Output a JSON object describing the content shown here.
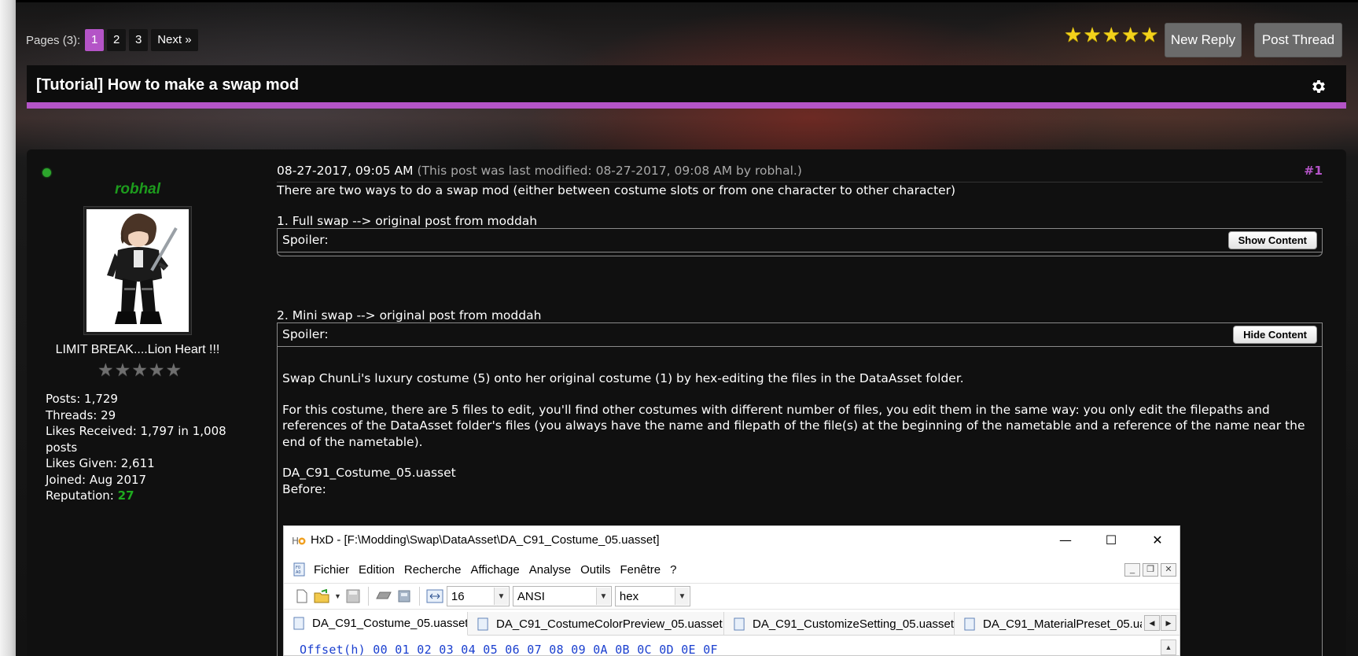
{
  "pagination": {
    "label": "Pages (3):",
    "pages": [
      "1",
      "2",
      "3"
    ],
    "current": "1",
    "next_label": "Next »"
  },
  "thread_rating": {
    "stars": 5,
    "max": 5
  },
  "actions": {
    "new_reply": "New Reply",
    "post_thread": "Post Thread"
  },
  "thread": {
    "title": "[Tutorial] How to make a swap mod"
  },
  "author": {
    "username": "robhal",
    "online": true,
    "user_title": "LIMIT BREAK....Lion Heart !!!",
    "stars": 0,
    "stars_max": 5,
    "stats": {
      "posts": "Posts: 1,729",
      "threads": "Threads: 29",
      "likes_received": "Likes Received: 1,797 in 1,008 posts",
      "likes_given": "Likes Given: 2,611",
      "joined": "Joined: Aug 2017",
      "reputation_label": "Reputation: ",
      "reputation_value": "27"
    }
  },
  "post": {
    "date": "08-27-2017, 09:05 AM",
    "modified": "(This post was last modified: 08-27-2017, 09:08 AM by robhal.)",
    "number": "#1",
    "intro": "There are two ways to do a swap mod (either between costume slots or from one character to other character)",
    "section1": "1. Full swap --> original post from moddah",
    "spoiler1_label": "Spoiler:",
    "spoiler1_button": "Show Content",
    "section2": "2. Mini swap --> original post from moddah",
    "spoiler2_label": "Spoiler:",
    "spoiler2_button": "Hide Content",
    "spoiler2_p1": "Swap ChunLi's luxury costume (5) onto her original costume (1) by hex-editing the files in the DataAsset folder.",
    "spoiler2_p2": "For this costume, there are 5 files to edit, you'll find other costumes with different number of files, you edit them in the same way: you only edit the filepaths and references of the DataAsset folder's files (you always have the name and filepath of the file(s) at the beginning of the nametable and a reference of the name near the end of the nametable).",
    "file_name": "DA_C91_Costume_05.uasset",
    "before_label": "Before:"
  },
  "hxd": {
    "title": "HxD - [F:\\Modding\\Swap\\DataAsset\\DA_C91_Costume_05.uasset]",
    "menu": [
      "Fichier",
      "Edition",
      "Recherche",
      "Affichage",
      "Analyse",
      "Outils",
      "Fenêtre",
      "?"
    ],
    "bytes_per_row": "16",
    "charset": "ANSI",
    "offset_base": "hex",
    "tabs": [
      "DA_C91_Costume_05.uasset",
      "DA_C91_CostumeColorPreview_05.uasset",
      "DA_C91_CustomizeSetting_05.uasset",
      "DA_C91_MaterialPreset_05.ua"
    ],
    "offset_header": "Offset(h)  00 01 02 03 04 05 06 07 08 09 0A 0B 0C 0D 0E 0F"
  },
  "colors": {
    "accent": "#b454c7",
    "online": "#2ca52c",
    "reputation": "#1faa1f",
    "star_active": "#f3d21b",
    "star_inactive": "#6e6e6e"
  },
  "icons": {
    "gear": "gear-icon",
    "online": "online-status-icon",
    "star": "star-icon"
  }
}
